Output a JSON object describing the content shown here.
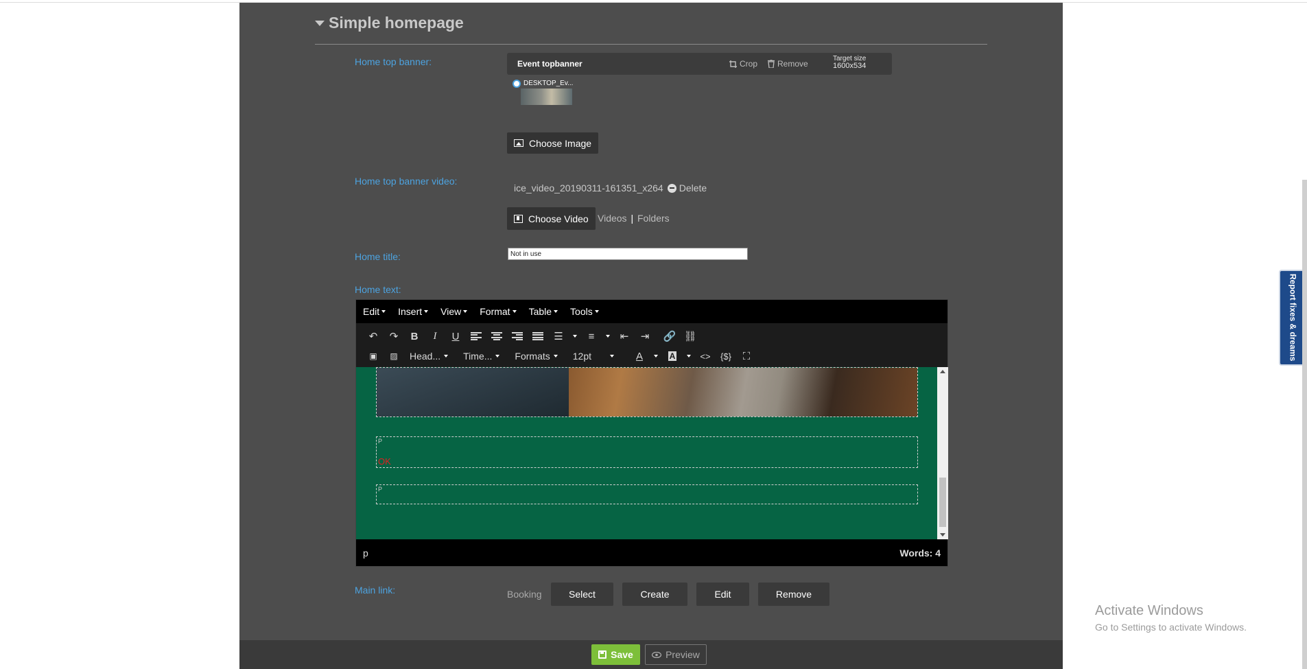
{
  "section": {
    "title": "Simple homepage"
  },
  "labels": {
    "top_banner": "Home top banner:",
    "top_banner_video": "Home top banner video:",
    "home_title": "Home title:",
    "home_text": "Home text:",
    "main_link": "Main link:"
  },
  "banner": {
    "name": "Event topbanner",
    "crop": "Crop",
    "remove": "Remove",
    "target_size_label": "Target size",
    "target_size_value": "1600x534",
    "thumb_label": "DESKTOP_Ev...",
    "choose_image": "Choose Image"
  },
  "video": {
    "file": "ice_video_20190311-161351_x264",
    "delete": "Delete",
    "choose_video": "Choose Video",
    "videos_link": "Videos",
    "separator": "|",
    "folders_link": "Folders"
  },
  "home_title": {
    "value": "Not in use"
  },
  "editor": {
    "menus": [
      "Edit",
      "Insert",
      "View",
      "Format",
      "Table",
      "Tools"
    ],
    "heading_select": "Head...",
    "font_select": "Time...",
    "formats_select": "Formats",
    "size_select": "12pt",
    "ok_text": "OK",
    "box_mark": "P",
    "path": "p",
    "words": "Words: 4"
  },
  "main_link": {
    "type": "Booking",
    "select": "Select",
    "create": "Create",
    "edit": "Edit",
    "remove": "Remove"
  },
  "footer": {
    "save": "Save",
    "preview": "Preview"
  },
  "side_tab": {
    "label": "Report fixes & dreams"
  },
  "watermark": {
    "line1": "Activate Windows",
    "line2": "Go to Settings to activate Windows."
  },
  "colors": {
    "panel": "#4d4d4d",
    "label_blue": "#4da3e0",
    "editor_bg": "#066444",
    "save_green": "#7dbf3a",
    "report_tab": "#1e4a8a"
  }
}
